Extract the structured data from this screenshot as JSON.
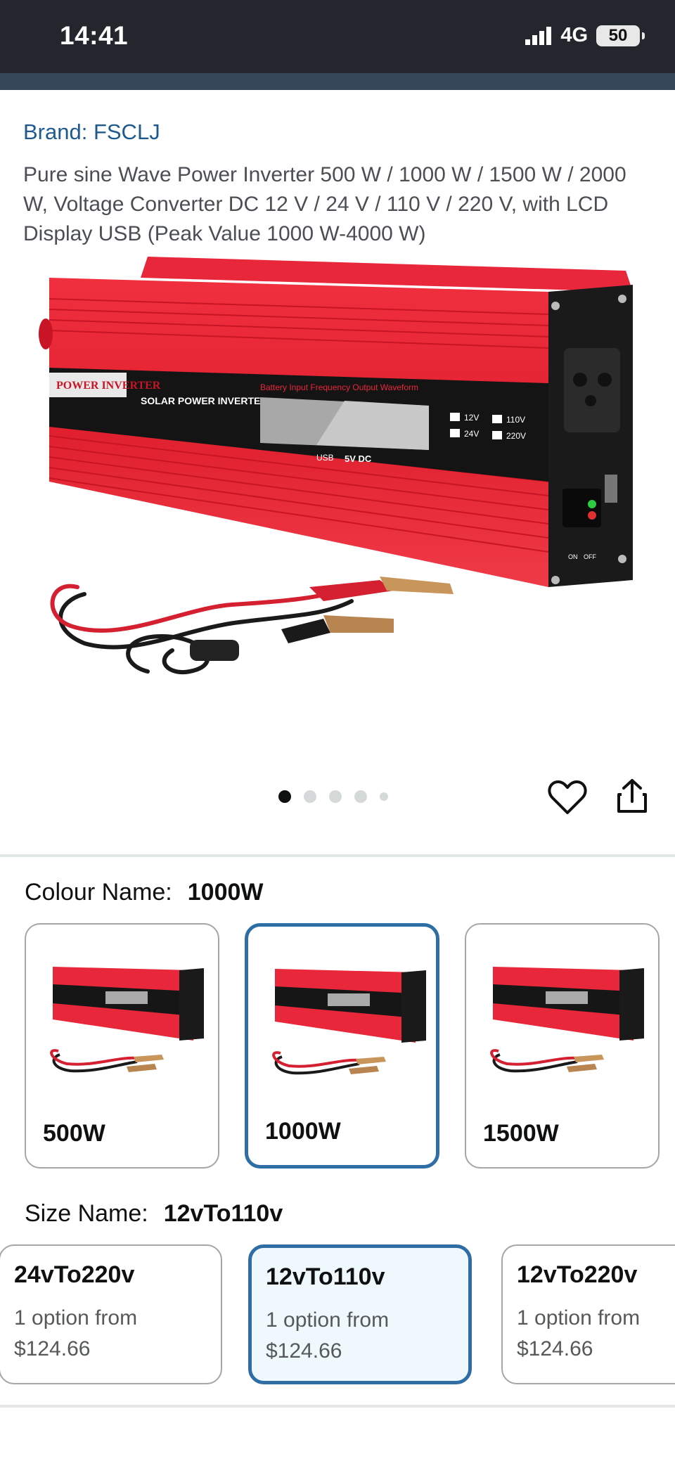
{
  "status_bar": {
    "time": "14:41",
    "network": "4G",
    "battery": "50"
  },
  "product": {
    "brand": "Brand: FSCLJ",
    "title": "Pure sine Wave Power Inverter 500 W / 1000 W / 1500 W / 2000 W, Voltage Converter DC 12 V / 24 V / 110 V / 220 V, with LCD Display USB (Peak Value 1000 W-4000 W)",
    "image_labels": {
      "badge": "POWER INVERTER",
      "model": "SOLAR POWER INVERTER",
      "display_caption": "Battery Input Frequency Output Waveform",
      "usb": "USB",
      "usb_out": "5V DC",
      "v12": "12V",
      "v24": "24V",
      "v110": "110V",
      "v220": "220V",
      "on": "ON",
      "off": "OFF"
    }
  },
  "gallery": {
    "total_images": 5,
    "active_index": 0
  },
  "colour": {
    "label": "Colour Name:",
    "selected": "1000W",
    "options": [
      {
        "label": "500W",
        "selected": false
      },
      {
        "label": "1000W",
        "selected": true
      },
      {
        "label": "1500W",
        "selected": false
      }
    ]
  },
  "size": {
    "label": "Size Name:",
    "selected": "12vTo110v",
    "options": [
      {
        "name": "24vTo220v",
        "line1": "1 option from",
        "price": "$124.66",
        "selected": false
      },
      {
        "name": "12vTo110v",
        "line1": "1 option from",
        "price": "$124.66",
        "selected": true
      },
      {
        "name": "12vTo220v",
        "line1": "1 option from",
        "price": "$124.66",
        "selected": false
      }
    ]
  },
  "colors": {
    "accent": "#2f6ea5",
    "brand_link": "#1f5a8e",
    "inverter_red": "#e8273a"
  }
}
